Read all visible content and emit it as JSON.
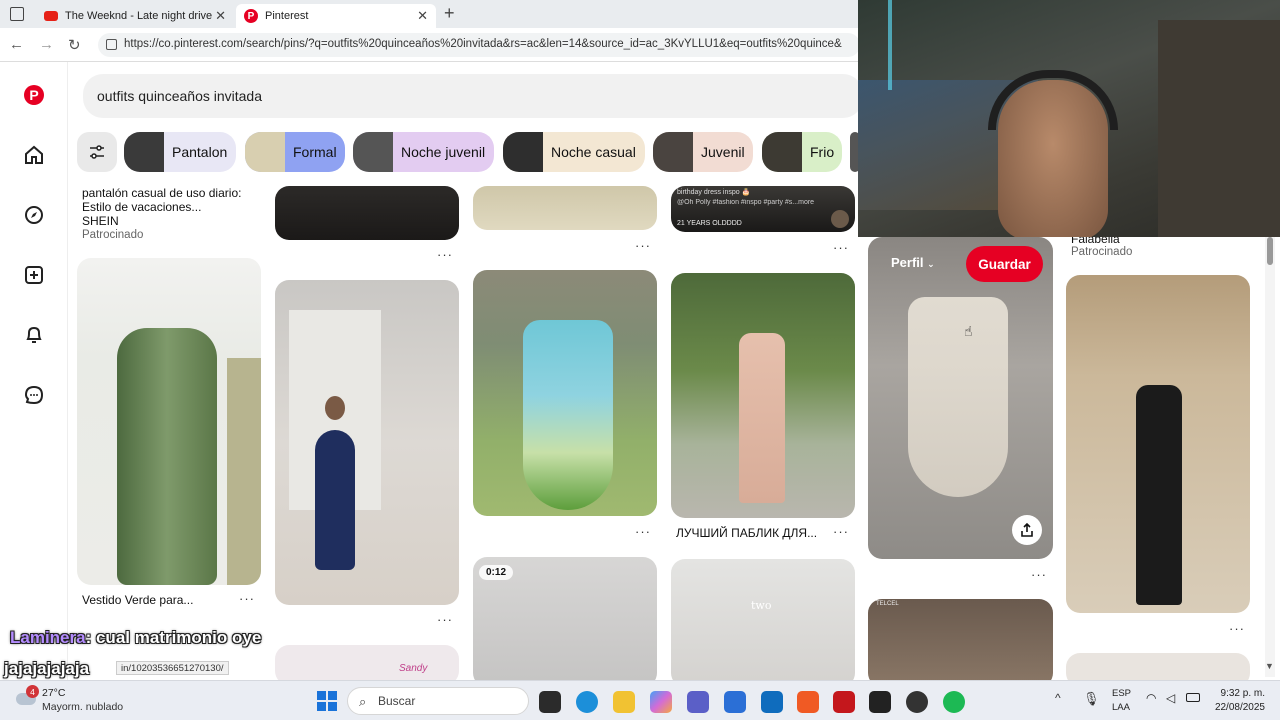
{
  "browser": {
    "tabs": [
      {
        "title": "The Weeknd - Late night drive pl..."
      },
      {
        "title": "Pinterest"
      }
    ],
    "new_tab": "+",
    "url": "https://co.pinterest.com/search/pins/?q=outfits%20quinceaños%20invitada&rs=ac&len=14&source_id=ac_3KvYLLU1&eq=outfits%20quince&"
  },
  "search": {
    "value": "outfits quinceaños invitada"
  },
  "chips": [
    {
      "label": "Pantalon",
      "color": "#e8e7f5"
    },
    {
      "label": "Formal",
      "color": "#8fa2f2"
    },
    {
      "label": "Noche juvenil",
      "color": "#e3ccf1"
    },
    {
      "label": "Noche casual",
      "color": "#f3e7d3"
    },
    {
      "label": "Juvenil",
      "color": "#f2dcd3"
    },
    {
      "label": "Frio",
      "color": "#d9efc8"
    }
  ],
  "pins": {
    "top_pin": {
      "title": "pantalón casual de uso diario: Estilo de vacaciones...",
      "brand": "SHEIN",
      "sponsored": "Patrocinado"
    },
    "green_dress": {
      "title": "Vestido Verde para..."
    },
    "russian": {
      "title": "ЛУЧШИЙ ПАБЛИК ДЛЯ..."
    },
    "video_badge": "0:12",
    "two_label": "two",
    "falabella": {
      "brand": "Falabella",
      "sponsored": "Patrocinado"
    },
    "hover": {
      "profile": "Perfil",
      "save": "Guardar"
    },
    "overlay_text": "birthday dress inspo 🎂",
    "overlay_text2": "@Oh Polly #fashion #inspo #party #s...more",
    "overlay_text3": "21 YEARS OLDDDD",
    "sandy": "Sandy",
    "telcel": "TELCEL"
  },
  "stream_chat": {
    "user": "Laminera",
    "message": ": cual matrimonio oye",
    "message2": "jajajajajaja",
    "status_url": "in/1020353665127013​0/"
  },
  "taskbar": {
    "temp": "27°C",
    "weather": "Mayorm. nublado",
    "search": "Buscar",
    "lang1": "ESP",
    "lang2": "LAA",
    "time": "9:32 p. m.",
    "date": "22/08/2025",
    "weather_badge": "4"
  },
  "colors": {
    "pinterest_red": "#e60023",
    "save_red": "#e60023"
  }
}
